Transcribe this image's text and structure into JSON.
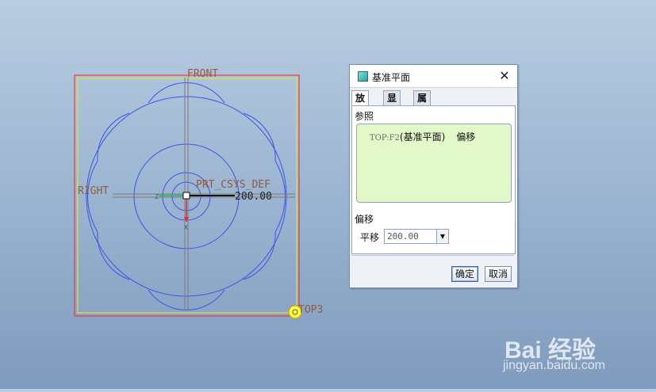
{
  "viewport": {
    "labels": {
      "front": "FRONT",
      "right": "RIGHT",
      "csys": "PRT_CSYS_DEF",
      "dimension": "200.00",
      "new_plane": "TOP3",
      "axis_z": "Z",
      "axis_x": "X"
    }
  },
  "dialog": {
    "title": "基准平面",
    "close_glyph": "✕",
    "tabs": [
      {
        "label": "放置"
      },
      {
        "label": "显示"
      },
      {
        "label": "属性"
      }
    ],
    "references_label": "参照",
    "reference_item": {
      "code": "TOP:F2",
      "type": "(基准平面)",
      "mode": "偏移"
    },
    "offset_section_label": "偏移",
    "translate_label": "平移",
    "translate_value": "200.00",
    "ok_label": "确定",
    "cancel_label": "取消"
  },
  "watermark": {
    "logo": "Bai 经验",
    "url": "jingyan.baidu.com"
  },
  "colors": {
    "sketch": "#3a55e6",
    "datum_border": "#e83a3a",
    "plane_edge": "#d8e34a",
    "reference_bg": "#e2f8c8",
    "highlight_marker": "#ffff3a"
  }
}
